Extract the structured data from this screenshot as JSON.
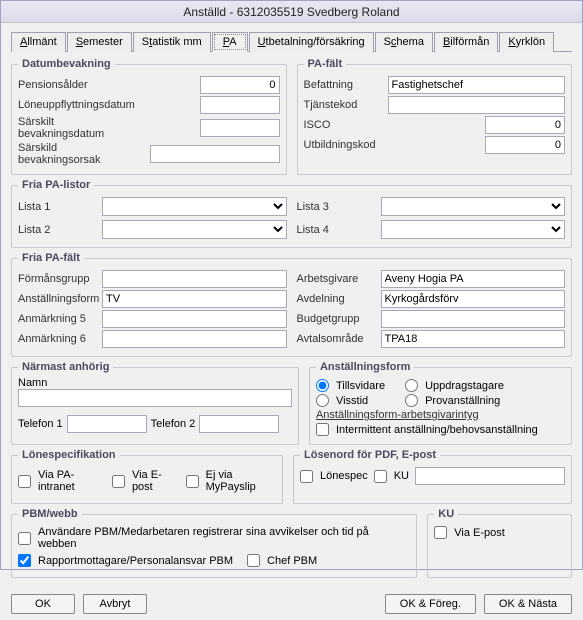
{
  "title": "Anställd - 6312035519  Svedberg Roland",
  "tabs": {
    "allmant": "Allmänt",
    "semester": "Semester",
    "statistik": "Statistik mm",
    "pa": "PA",
    "utbetalning": "Utbetalning/försäkring",
    "schema": "Schema",
    "bilforman": "Bilförmån",
    "kyrklon": "Kyrklön"
  },
  "datumbevakning": {
    "legend": "Datumbevakning",
    "pensionsalder_label": "Pensionsålder",
    "pensionsalder_value": "0",
    "loneuppflyttning_label": "Löneuppflyttningsdatum",
    "loneuppflyttning_value": "",
    "sarskilt_datum_label": "Särskilt bevakningsdatum",
    "sarskilt_datum_value": "",
    "sarskild_orsak_label": "Särskild bevakningsorsak",
    "sarskild_orsak_value": ""
  },
  "pafalt": {
    "legend": "PA-fält",
    "befattning_label": "Befattning",
    "befattning_value": "Fastighetschef",
    "tjanstekod_label": "Tjänstekod",
    "tjanstekod_value": "",
    "isco_label": "ISCO",
    "isco_value": "0",
    "utbildningskod_label": "Utbildningskod",
    "utbildningskod_value": "0"
  },
  "fria_listor": {
    "legend": "Fria PA-listor",
    "lista1_label": "Lista 1",
    "lista1_value": "",
    "lista2_label": "Lista 2",
    "lista2_value": "",
    "lista3_label": "Lista 3",
    "lista3_value": "",
    "lista4_label": "Lista 4",
    "lista4_value": ""
  },
  "fria_falt": {
    "legend": "Fria PA-fält",
    "formansgrupp_label": "Förmånsgrupp",
    "formansgrupp_value": "",
    "anstallningsform_label": "Anställningsform",
    "anstallningsform_value": "TV",
    "anmarkning5_label": "Anmärkning 5",
    "anmarkning5_value": "",
    "anmarkning6_label": "Anmärkning 6",
    "anmarkning6_value": "",
    "arbetsgivare_label": "Arbetsgivare",
    "arbetsgivare_value": "Aveny Hogia PA",
    "avdelning_label": "Avdelning",
    "avdelning_value": "Kyrkogårdsförv",
    "budgetgrupp_label": "Budgetgrupp",
    "budgetgrupp_value": "",
    "avtalsomrade_label": "Avtalsområde",
    "avtalsomrade_value": "TPA18"
  },
  "narmast": {
    "legend": "Närmast anhörig",
    "namn_label": "Namn",
    "namn_value": "",
    "telefon1_label": "Telefon 1",
    "telefon1_value": "",
    "telefon2_label": "Telefon 2",
    "telefon2_value": ""
  },
  "anst_form": {
    "legend": "Anställningsform",
    "tillsvidare": "Tillsvidare",
    "uppdragstagare": "Uppdragstagare",
    "visstid": "Visstid",
    "provanstallning": "Provanställning",
    "link": "Anställningsform-arbetsgivarintyg",
    "intermittent": "Intermittent anställning/behovsanställning"
  },
  "lonespec": {
    "legend": "Lönespecifikation",
    "via_intranet": "Via PA-intranet",
    "via_epost": "Via E-post",
    "ej_mypayslip": "Ej via MyPayslip"
  },
  "losenord": {
    "legend": "Lösenord för PDF, E-post",
    "lonespec": "Lönespec",
    "ku": "KU",
    "value": ""
  },
  "pbm": {
    "legend": "PBM/webb",
    "anvandare": "Användare PBM/Medarbetaren registrerar sina avvikelser och tid på webben",
    "rapport": "Rapportmottagare/Personalansvar PBM",
    "chef": "Chef PBM"
  },
  "ku": {
    "legend": "KU",
    "via_epost": "Via E-post"
  },
  "buttons": {
    "ok": "OK",
    "avbryt": "Avbryt",
    "ok_foreg": "OK & Föreg.",
    "ok_nasta": "OK & Nästa"
  }
}
